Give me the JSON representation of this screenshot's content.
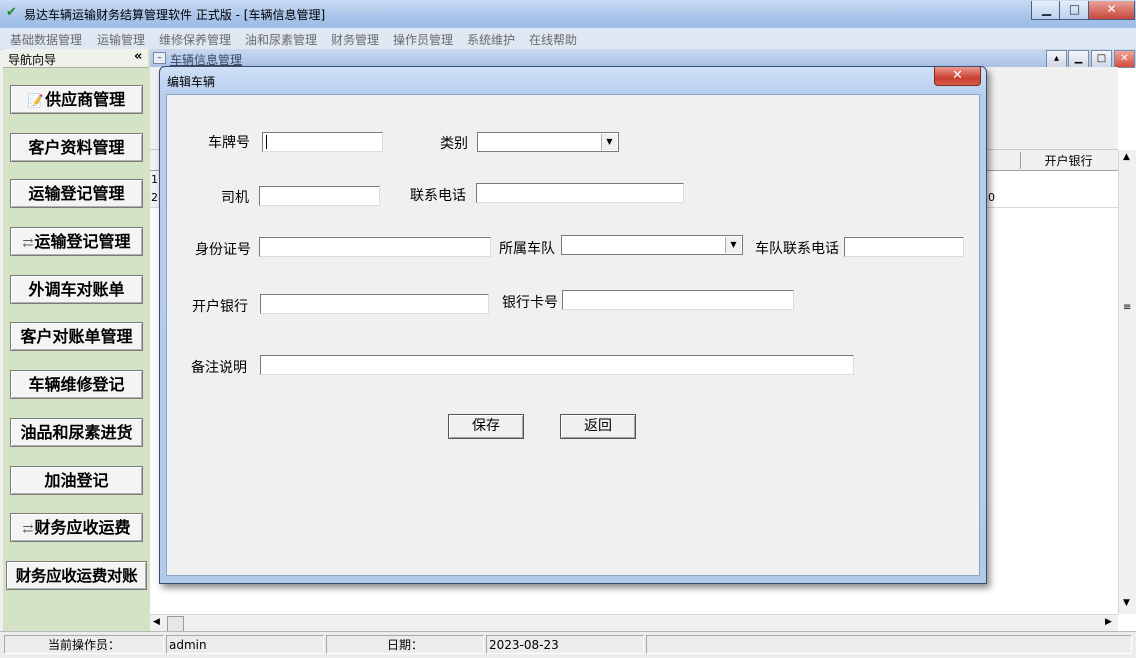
{
  "window": {
    "title": "易达车辆运输财务结算管理软件  正式版   - [车辆信息管理]"
  },
  "menu": [
    "基础数据管理",
    "运输管理",
    "维修保养管理",
    "油和尿素管理",
    "财务管理",
    "操作员管理",
    "系统维护",
    "在线帮助"
  ],
  "nav": {
    "header": "导航向导",
    "collapse": "«",
    "items": [
      {
        "label": "供应商管理",
        "icon": "doc-pencil-icon"
      },
      {
        "label": "客户资料管理"
      },
      {
        "label": "运输登记管理"
      },
      {
        "label": "运输登记管理",
        "icon": "link-icon"
      },
      {
        "label": "外调车对账单"
      },
      {
        "label": "客户对账单管理"
      },
      {
        "label": "车辆维修登记"
      },
      {
        "label": "油品和尿素进货"
      },
      {
        "label": "加油登记"
      },
      {
        "label": "财务应收运费",
        "icon": "link-icon"
      },
      {
        "label": "财务应收运费对账"
      }
    ]
  },
  "child": {
    "title": "车辆信息管理",
    "column_header": "开户银行",
    "row_numbers": [
      "1",
      "2"
    ],
    "row2_tail": "0"
  },
  "dialog": {
    "title": "编辑车辆",
    "labels": {
      "plate": "车牌号",
      "category": "类别",
      "driver": "司机",
      "phone": "联系电话",
      "id_number": "身份证号",
      "fleet": "所属车队",
      "fleet_phone": "车队联系电话",
      "bank": "开户银行",
      "bank_card": "银行卡号",
      "remark": "备注说明"
    },
    "values": {
      "plate": "",
      "category": "",
      "driver": "",
      "phone": "",
      "id_number": "",
      "fleet": "",
      "fleet_phone": "",
      "bank": "",
      "bank_card": "",
      "remark": ""
    },
    "buttons": {
      "save": "保存",
      "back": "返回"
    }
  },
  "status": {
    "operator_label": "当前操作员：",
    "operator": "admin",
    "date_label": "日期：",
    "date": "2023-08-23"
  }
}
